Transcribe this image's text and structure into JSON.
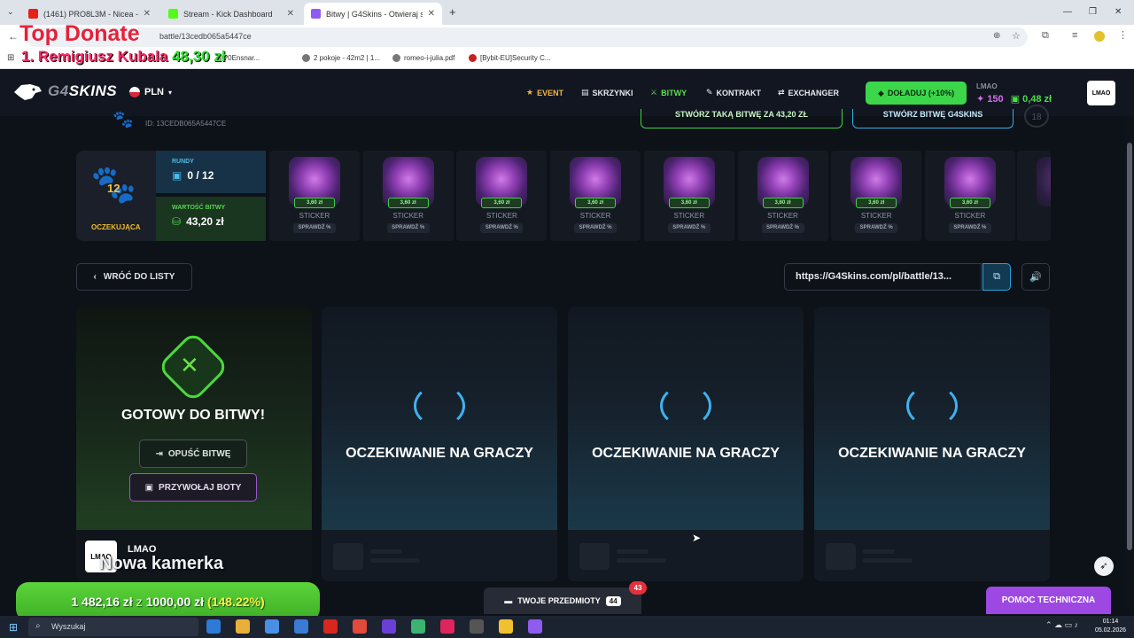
{
  "browser": {
    "tabs": [
      {
        "title": "(1461) PRO8L3M - Nicea - Y",
        "favicon_color": "#e62117",
        "active": false
      },
      {
        "title": "Stream - Kick Dashboard",
        "favicon_color": "#53fc18",
        "active": false
      },
      {
        "title": "Bitwy | G4Skins - Otwieraj skrzy",
        "favicon_color": "#8e5cf0",
        "active": true
      }
    ],
    "new_tab": "+",
    "url": "battle/13cedb065a5447ce",
    "bookmarks": [
      "2 pokoje - 42m2 | 1...",
      "romeo-i-julia.pdf",
      "[Bybit-EU]Security C...",
      "M?0Ensnar..."
    ],
    "apps_icon": "apps-grid-icon"
  },
  "overlay": {
    "title": "Top Donate",
    "rank": "1.",
    "name": "Remigiusz Kubala",
    "amount": "48,30 zł"
  },
  "site": {
    "logo": "G4SKINS",
    "currency": "PLN",
    "nav": [
      {
        "label": "EVENT",
        "icon": "star-icon"
      },
      {
        "label": "SKRZYNKI",
        "icon": "cases-icon"
      },
      {
        "label": "BITWY",
        "icon": "battle-icon"
      },
      {
        "label": "KONTRAKT",
        "icon": "pen-icon"
      },
      {
        "label": "EXCHANGER",
        "icon": "exchange-icon"
      }
    ],
    "deposit_label": "DOŁADUJ (+10%)",
    "user": {
      "name": "LMAO",
      "coins": "150",
      "balance": "0,48 zł",
      "avatar_text": "LMAO"
    }
  },
  "battle": {
    "id": "ID: 13CEDB065A5447CE",
    "create_same": "STWÓRZ TAKĄ BITWĘ ZA 43,20 ZŁ",
    "create_g4skins": "STWÓRZ BITWĘ G4SKINS",
    "count_badge": "18",
    "paw_number": "12",
    "status": "OCZEKUJĄCA",
    "rounds_label": "RUNDY",
    "rounds_value": "0 / 12",
    "value_label": "WARTOŚĆ BITWY",
    "value_amount": "43,20 zł",
    "cases": [
      {
        "price": "3,60 zł",
        "name": "STICKER",
        "check": "SPRAWDŹ %"
      },
      {
        "price": "3,60 zł",
        "name": "STICKER",
        "check": "SPRAWDŹ %"
      },
      {
        "price": "3,60 zł",
        "name": "STICKER",
        "check": "SPRAWDŹ %"
      },
      {
        "price": "3,60 zł",
        "name": "STICKER",
        "check": "SPRAWDŹ %"
      },
      {
        "price": "3,60 zł",
        "name": "STICKER",
        "check": "SPRAWDŹ %"
      },
      {
        "price": "3,60 zł",
        "name": "STICKER",
        "check": "SPRAWDŹ %"
      },
      {
        "price": "3,60 zł",
        "name": "STICKER",
        "check": "SPRAWDŹ %"
      },
      {
        "price": "3,60 zł",
        "name": "STICKER",
        "check": "SPRAWDŹ %"
      }
    ],
    "back_label": "WRÓĆ DO LISTY",
    "share_url": "https://G4Skins.com/pl/battle/13...",
    "player_panel": {
      "ready_text": "GOTOWY DO BITWY!",
      "leave_label": "OPUŚĆ BITWĘ",
      "bots_label": "PRZYWOŁAJ BOTY",
      "player_name": "LMAO",
      "avatar_text": "LMAO",
      "camera_overlay": "Nowa kamerka"
    },
    "waiting_text": "OCZEKIWANIE NA GRACZY"
  },
  "bottom": {
    "donate_current": "1 482,16 zł",
    "donate_word": "z",
    "donate_goal": "1000,00 zł",
    "donate_pct": "(148.22%)",
    "items_label": "TWOJE PRZEDMIOTY",
    "items_count": "44",
    "items_badge": "43",
    "help_label": "POMOC TECHNICZNA"
  },
  "taskbar": {
    "search_placeholder": "Wyszukaj",
    "time": "01:14",
    "date": "05.02.2026"
  }
}
